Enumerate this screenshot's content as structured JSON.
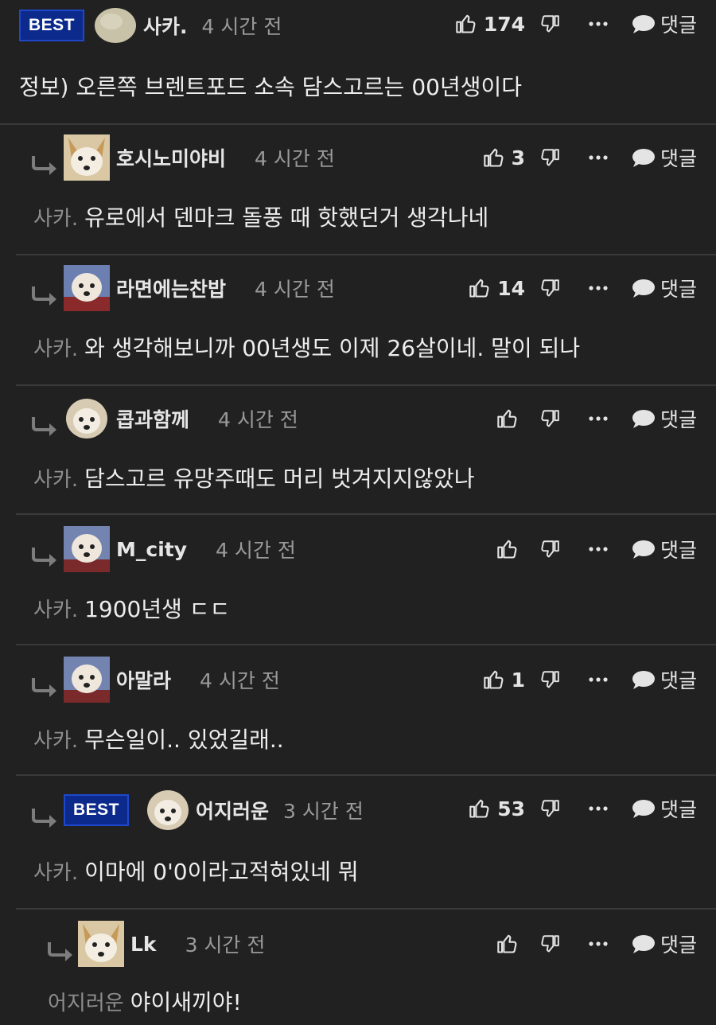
{
  "labels": {
    "reply": "댓글",
    "best": "BEST"
  },
  "comments": [
    {
      "nick": "사카.",
      "time": "4 시간 전",
      "likes": "174",
      "best": true,
      "mention": "",
      "text": "정보) 오른쪽 브렌트포드 소속 담스고르는 00년생이다"
    },
    {
      "nick": "호시노미야비",
      "time": "4 시간 전",
      "likes": "3",
      "best": false,
      "mention": "사카.",
      "text": "유로에서 덴마크 돌풍 때 핫했던거 생각나네"
    },
    {
      "nick": "라면에는찬밥",
      "time": "4 시간 전",
      "likes": "14",
      "best": false,
      "mention": "사카.",
      "text": "와 생각해보니까 00년생도 이제 26살이네. 말이 되나"
    },
    {
      "nick": "콥과함께",
      "time": "4 시간 전",
      "likes": "",
      "best": false,
      "mention": "사카.",
      "text": "담스고르 유망주때도 머리 벗겨지지않았나"
    },
    {
      "nick": "M_city",
      "time": "4 시간 전",
      "likes": "",
      "best": false,
      "mention": "사카.",
      "text": "1900년생 ㄷㄷ"
    },
    {
      "nick": "아말라",
      "time": "4 시간 전",
      "likes": "1",
      "best": false,
      "mention": "사카.",
      "text": "무슨일이.. 있었길래.."
    },
    {
      "nick": "어지러운",
      "time": "3 시간 전",
      "likes": "53",
      "best": true,
      "mention": "사카.",
      "text": "이마에 0'0이라고적혀있네 뭐"
    },
    {
      "nick": "Lk",
      "time": "3 시간 전",
      "likes": "",
      "best": false,
      "mention": "어지러운",
      "text": "야이새끼야!"
    }
  ]
}
